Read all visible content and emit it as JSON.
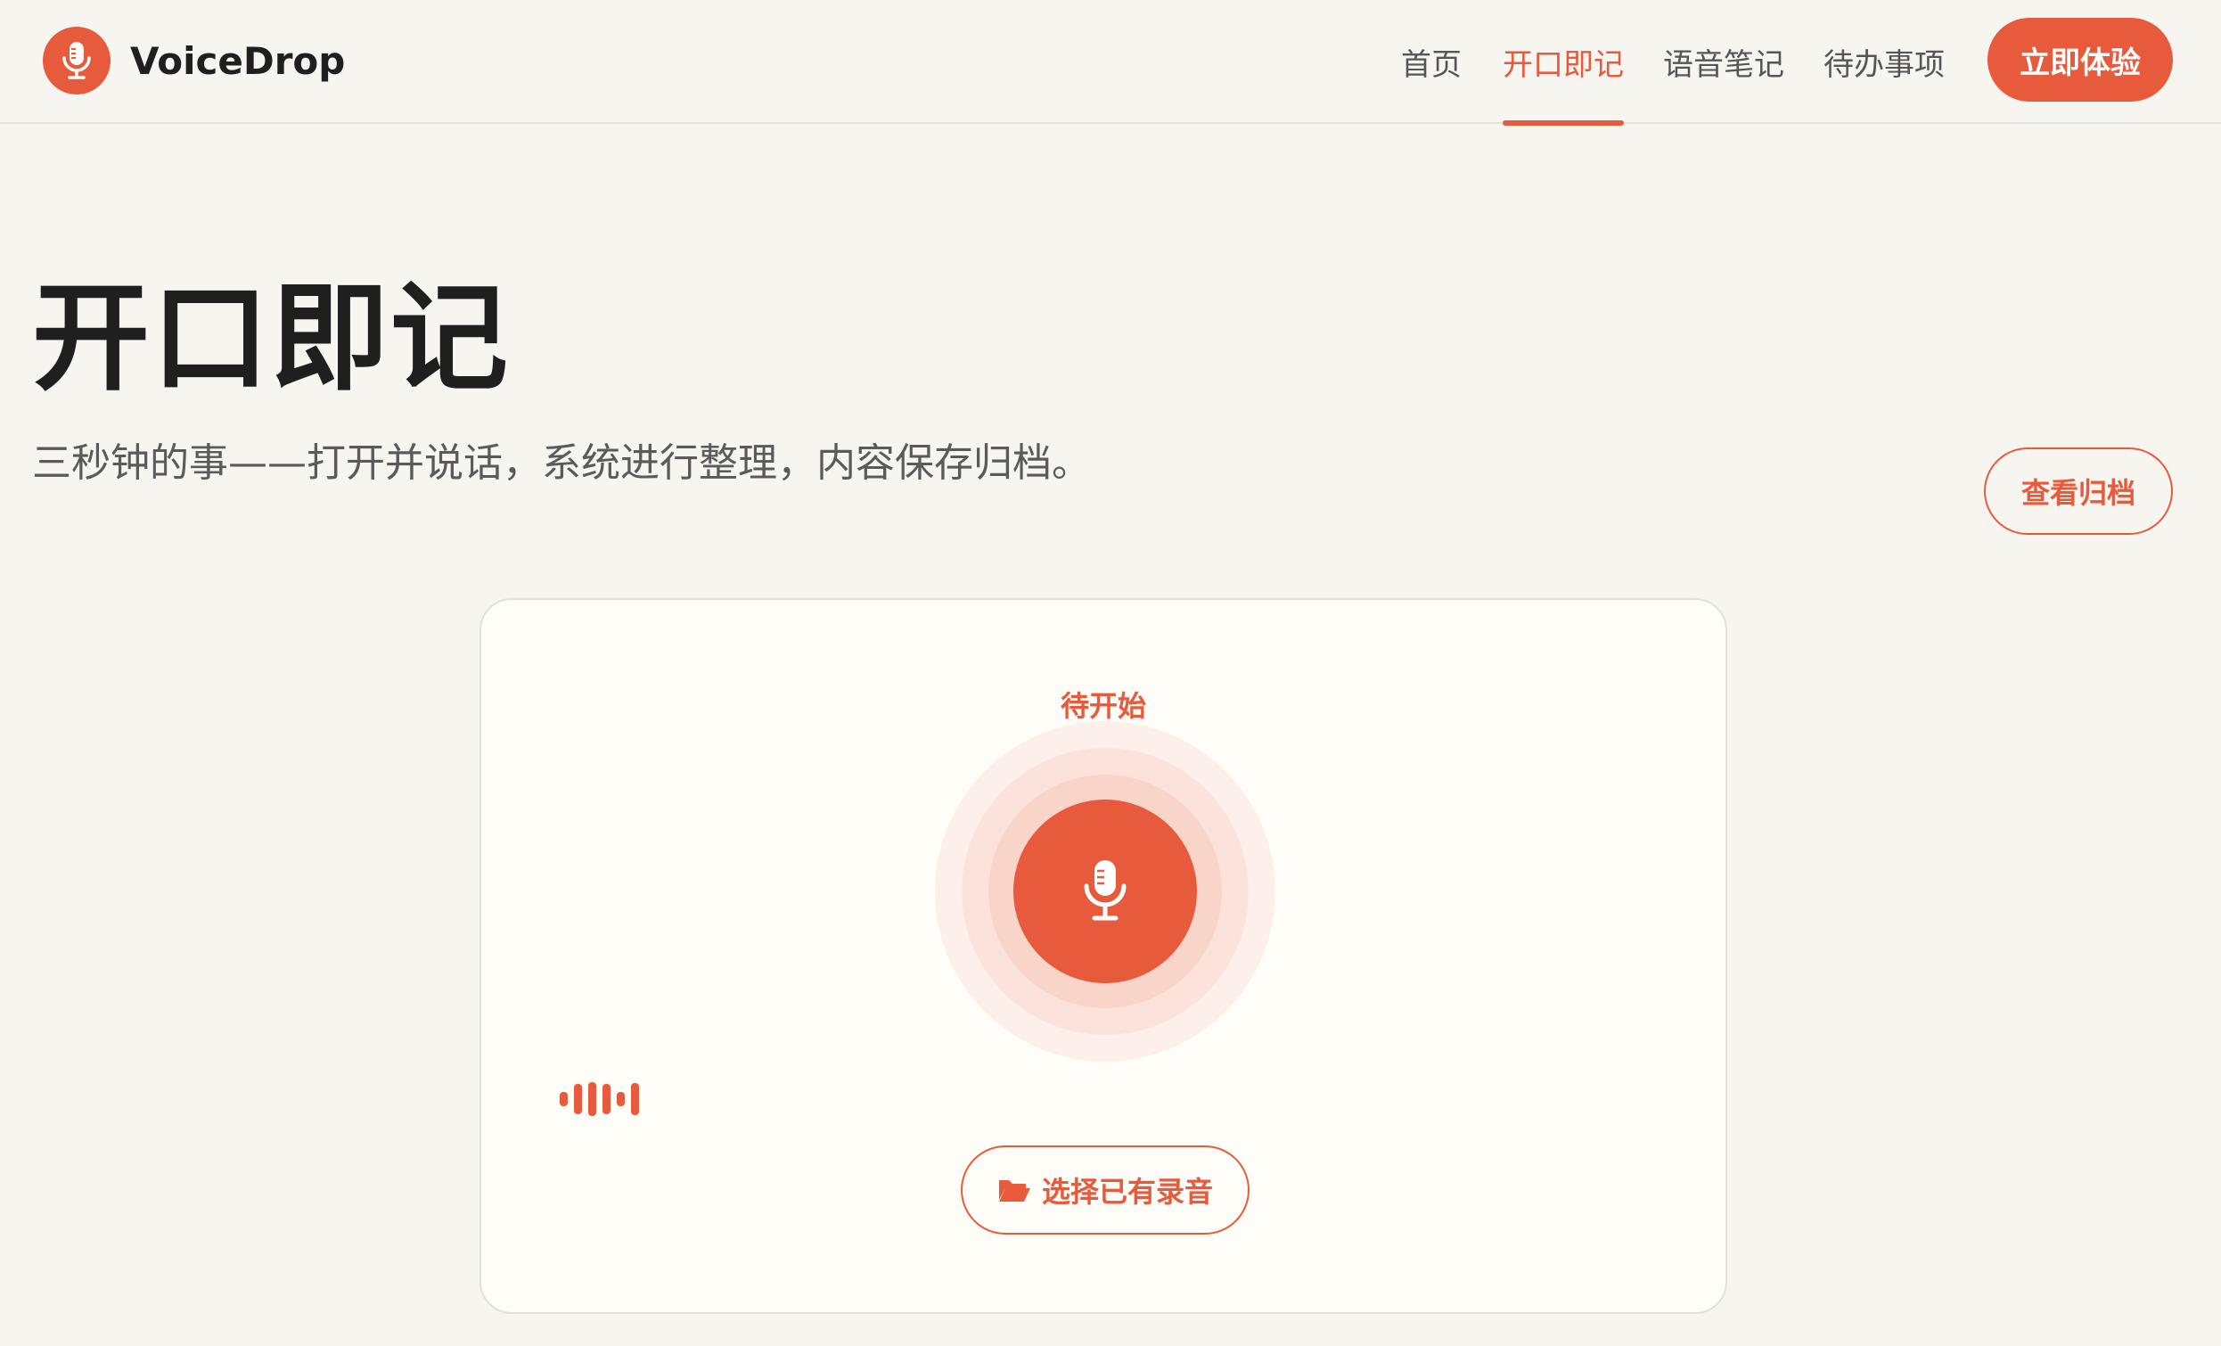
{
  "header": {
    "brand_name": "VoiceDrop",
    "brand_icon": "microphone-icon",
    "nav": [
      {
        "label": "首页",
        "active": false
      },
      {
        "label": "开口即记",
        "active": true
      },
      {
        "label": "语音笔记",
        "active": false
      },
      {
        "label": "待办事项",
        "active": false
      }
    ],
    "cta_label": "立即体验"
  },
  "hero": {
    "title": "开口即记",
    "subtitle": "三秒钟的事——打开并说话，系统进行整理，内容保存归档。",
    "archive_button": "查看归档"
  },
  "recorder": {
    "status": "待开始",
    "mic_icon": "microphone-icon",
    "wave_icon": "waveform-icon",
    "pick_icon": "folder-open-icon",
    "pick_label": "选择已有录音"
  },
  "colors": {
    "accent": "#e85a3c",
    "background": "#f7f5f0",
    "card": "#fffdf8"
  }
}
